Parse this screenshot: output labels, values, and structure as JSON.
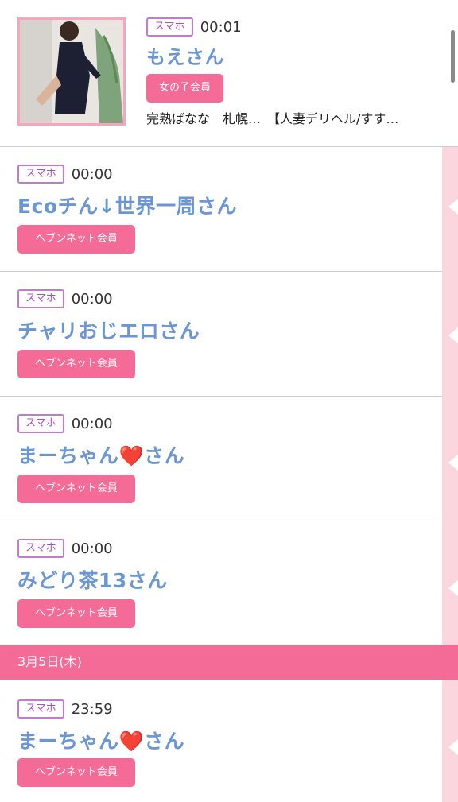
{
  "top_entry": {
    "device_badge": "スマホ",
    "time": "00:01",
    "name": "もえさん",
    "member_badge": "女の子会員",
    "description": "完熟ばなな　札幌…　【人妻デリヘル/すす…"
  },
  "entries": [
    {
      "device_badge": "スマホ",
      "time": "00:00",
      "name": "Ecoチん↓世界一周さん",
      "member_badge": "ヘブンネット会員"
    },
    {
      "device_badge": "スマホ",
      "time": "00:00",
      "name": "チャリおじエロさん",
      "member_badge": "ヘブンネット会員"
    },
    {
      "device_badge": "スマホ",
      "time": "00:00",
      "name": "まーちゃん❤️さん",
      "member_badge": "ヘブンネット会員"
    },
    {
      "device_badge": "スマホ",
      "time": "00:00",
      "name": "みどり茶13さん",
      "member_badge": "ヘブンネット会員"
    },
    {
      "device_badge": "スマホ",
      "time": "23:59",
      "name": "まーちゃん❤️さん",
      "member_badge": "ヘブンネット会員"
    }
  ],
  "date_header": "3月5日(木)",
  "colors": {
    "accent_pink": "#f56b97",
    "badge_purple": "#a950c7",
    "name_blue": "#6a96d3",
    "side_strip": "#fbd6df"
  }
}
